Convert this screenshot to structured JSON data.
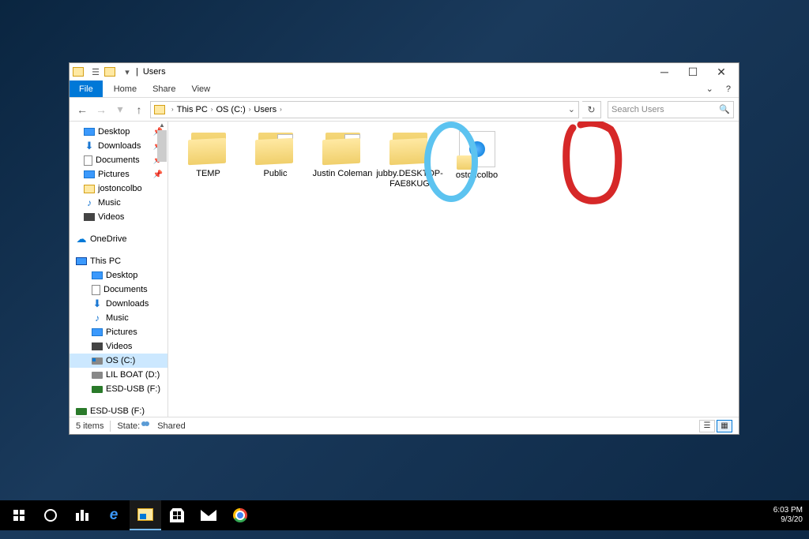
{
  "window": {
    "title": "Users"
  },
  "ribbon": {
    "file": "File",
    "home": "Home",
    "share": "Share",
    "view": "View"
  },
  "breadcrumb": {
    "root": "This PC",
    "drive": "OS (C:)",
    "folder": "Users"
  },
  "search": {
    "placeholder": "Search Users"
  },
  "nav": {
    "desktop": "Desktop",
    "downloads": "Downloads",
    "documents": "Documents",
    "pictures": "Pictures",
    "user_folder": "jostoncolbo",
    "music": "Music",
    "videos": "Videos",
    "onedrive": "OneDrive",
    "thispc": "This PC",
    "pc_desktop": "Desktop",
    "pc_documents": "Documents",
    "pc_downloads": "Downloads",
    "pc_music": "Music",
    "pc_pictures": "Pictures",
    "pc_videos": "Videos",
    "drive_os": "OS (C:)",
    "drive_lil": "LIL BOAT (D:)",
    "drive_esd": "ESD-USB (F:)",
    "removable": "ESD-USB (F:)"
  },
  "items": {
    "temp": "TEMP",
    "public": "Public",
    "justin": "Justin Coleman",
    "jubby": "jubby.DESKTOP-FAE8KUG",
    "profile_file": "ostoncolbo"
  },
  "status": {
    "count": "5 items",
    "state_label": "State:",
    "state_value": "Shared"
  },
  "tray": {
    "time": "6:03 PM",
    "date": "9/3/20"
  }
}
